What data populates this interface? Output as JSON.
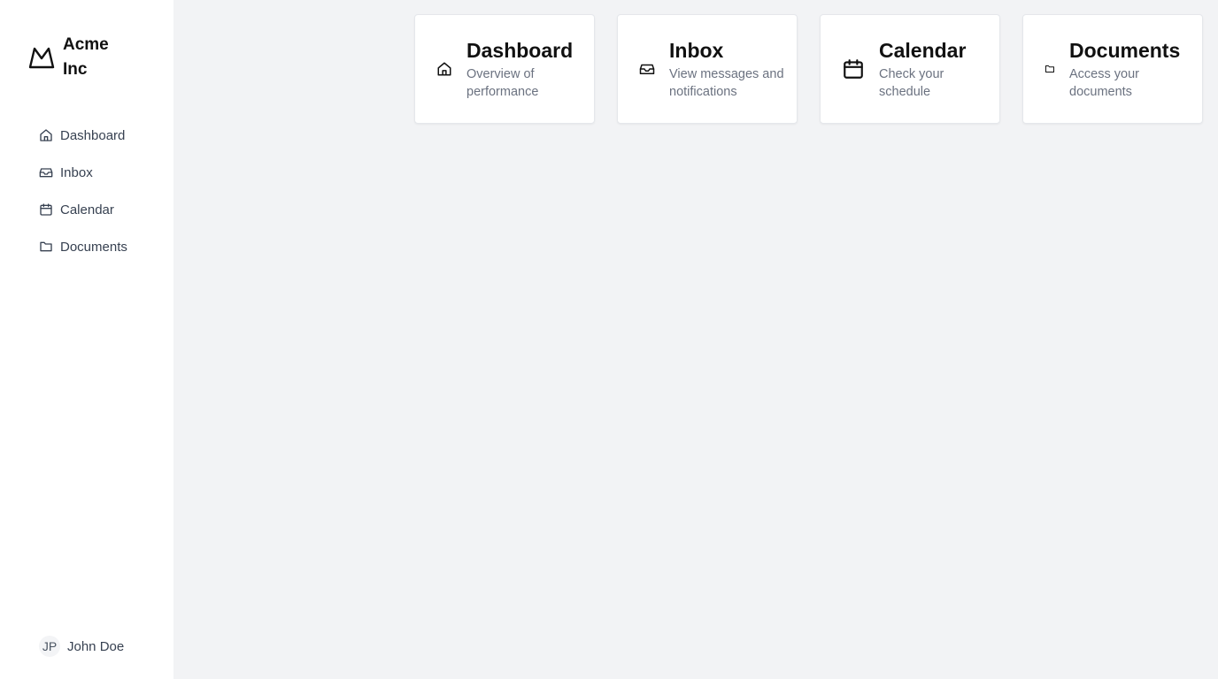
{
  "brand": {
    "name": "Acme Inc",
    "logo_icon": "mountain-logo-icon"
  },
  "sidebar": {
    "items": [
      {
        "label": "Dashboard",
        "icon": "home-icon"
      },
      {
        "label": "Inbox",
        "icon": "inbox-icon"
      },
      {
        "label": "Calendar",
        "icon": "calendar-icon"
      },
      {
        "label": "Documents",
        "icon": "folder-icon"
      }
    ],
    "user": {
      "initials": "JP",
      "name": "John Doe"
    }
  },
  "cards": [
    {
      "title": "Dashboard",
      "description": "Overview of performance",
      "icon": "home-icon"
    },
    {
      "title": "Inbox",
      "description": "View messages and notifications",
      "icon": "inbox-icon"
    },
    {
      "title": "Calendar",
      "description": "Check your schedule",
      "icon": "calendar-icon"
    },
    {
      "title": "Documents",
      "description": "Access your documents",
      "icon": "folder-icon"
    }
  ],
  "colors": {
    "sidebar_bg": "#ffffff",
    "main_bg": "#f2f3f5",
    "text": "#111827",
    "muted": "#6b7280"
  }
}
